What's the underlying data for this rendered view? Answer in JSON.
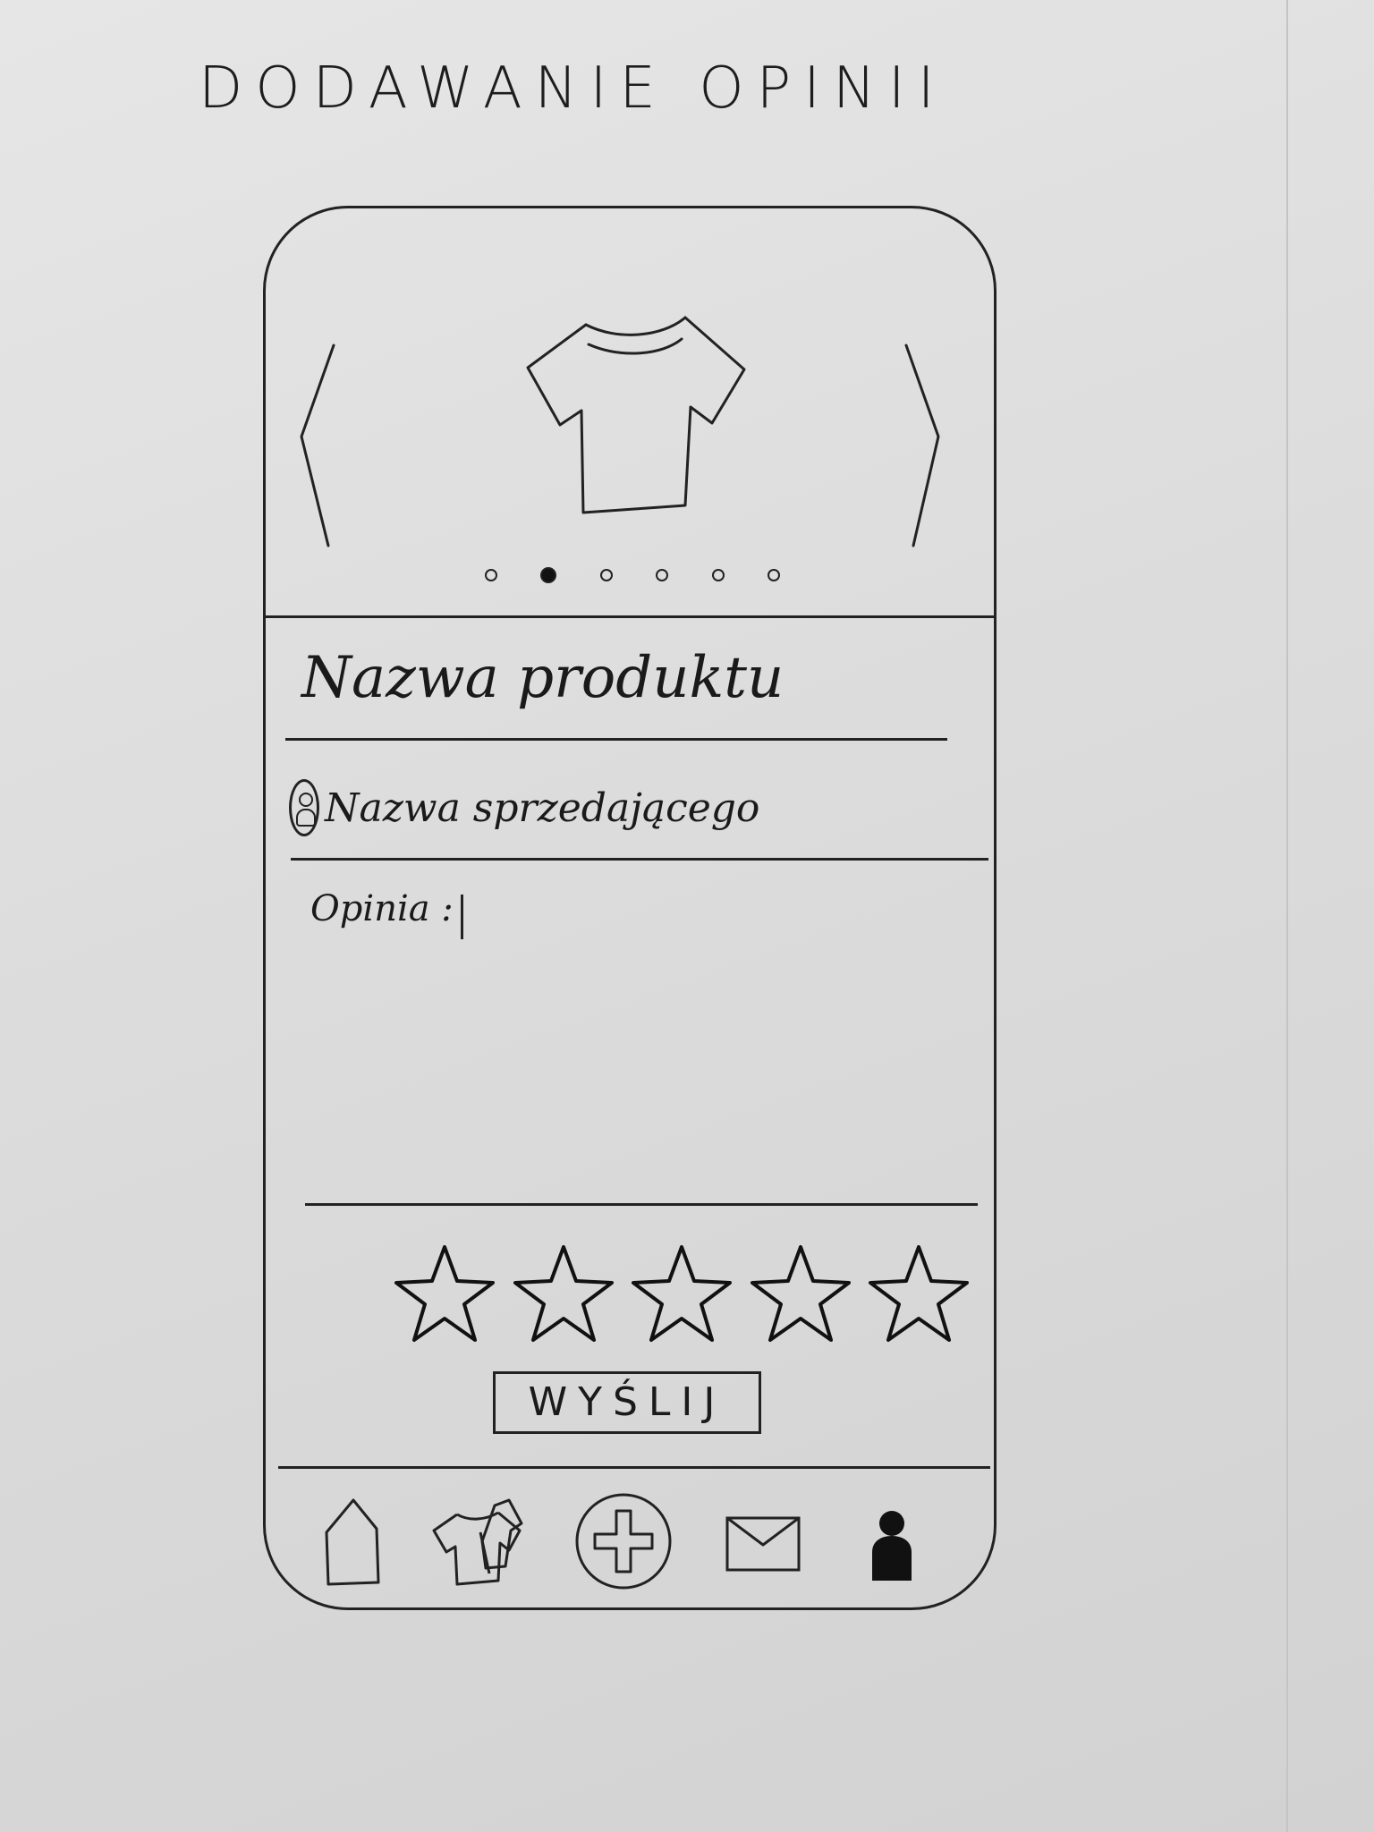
{
  "sketch": {
    "title": "DODAWANIE OPINII"
  },
  "carousel": {
    "prev_icon": "chevron-left-icon",
    "next_icon": "chevron-right-icon",
    "image_icon": "tshirt-icon",
    "page_count": 6,
    "active_index": 1
  },
  "product": {
    "name": "Nazwa produktu"
  },
  "seller": {
    "name": "Nazwa sprzedającego",
    "icon": "user-icon"
  },
  "opinion": {
    "label": "Opinia :"
  },
  "rating": {
    "max": 5,
    "icon": "star-icon"
  },
  "actions": {
    "send_label": "WYŚLIJ"
  },
  "tab_bar": {
    "items": [
      {
        "icon": "home-icon"
      },
      {
        "icon": "clothes-icon"
      },
      {
        "icon": "add-circle-icon"
      },
      {
        "icon": "mail-icon"
      },
      {
        "icon": "profile-icon"
      }
    ]
  }
}
